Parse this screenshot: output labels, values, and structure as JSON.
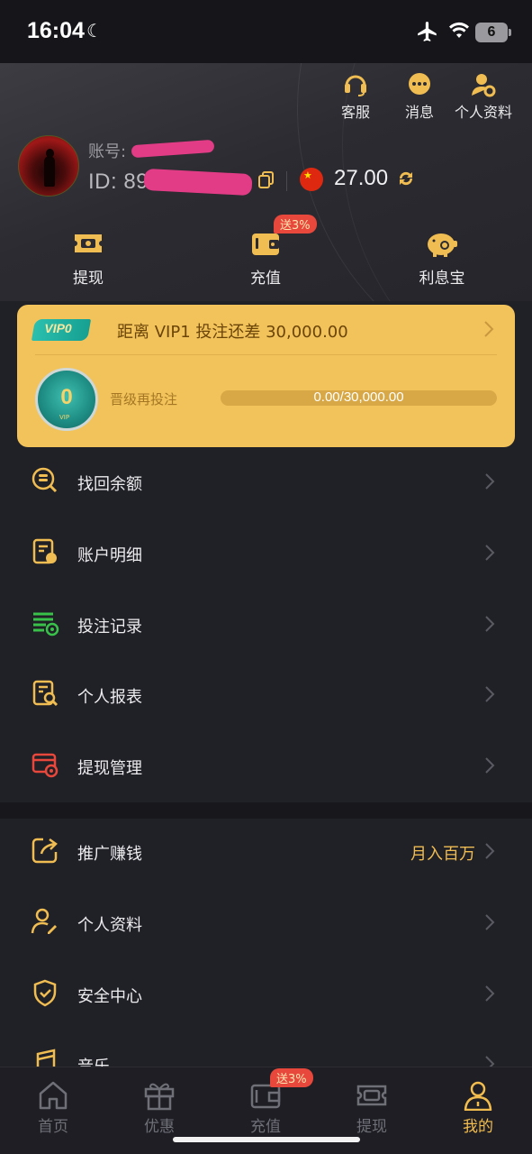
{
  "status_bar": {
    "time": "16:04",
    "battery": "6"
  },
  "header": {
    "actions": [
      {
        "label": "客服",
        "icon": "headset-icon"
      },
      {
        "label": "消息",
        "icon": "message-icon"
      },
      {
        "label": "个人资料",
        "icon": "user-settings-icon"
      }
    ],
    "account_label": "账号:",
    "id_label": "ID: 89",
    "balance": "27.00"
  },
  "quick_actions": [
    {
      "label": "提现",
      "icon": "withdraw-ticket-icon"
    },
    {
      "label": "充值",
      "icon": "wallet-icon",
      "badge": "送3%"
    },
    {
      "label": "利息宝",
      "icon": "piggy-bank-icon"
    }
  ],
  "vip": {
    "level_badge": "VIP0",
    "message": "距离 VIP1 投注还差 30,000.00",
    "medal_level": "0",
    "medal_caption": "VIP",
    "progress_label": "晋级再投注",
    "progress_text": "0.00/30,000.00",
    "progress_fraction": 0.0
  },
  "menu_group_1": [
    {
      "label": "找回余额",
      "icon": "recover-balance-icon",
      "color": "#f0bd52"
    },
    {
      "label": "账户明细",
      "icon": "account-detail-icon",
      "color": "#f0bd52"
    },
    {
      "label": "投注记录",
      "icon": "bet-record-icon",
      "color": "#39c24a"
    },
    {
      "label": "个人报表",
      "icon": "report-search-icon",
      "color": "#f0bd52"
    },
    {
      "label": "提现管理",
      "icon": "withdraw-manage-icon",
      "color": "#e8483c"
    }
  ],
  "menu_group_2": [
    {
      "label": "推广赚钱",
      "icon": "share-icon",
      "extra": "月入百万"
    },
    {
      "label": "个人资料",
      "icon": "user-edit-icon"
    },
    {
      "label": "安全中心",
      "icon": "shield-icon"
    },
    {
      "label": "音乐",
      "icon": "music-icon"
    }
  ],
  "bottom_nav": [
    {
      "label": "首页",
      "icon": "home-icon"
    },
    {
      "label": "优惠",
      "icon": "gift-icon"
    },
    {
      "label": "充值",
      "icon": "wallet-icon",
      "badge": "送3%"
    },
    {
      "label": "提现",
      "icon": "withdraw-ticket-icon"
    },
    {
      "label": "我的",
      "icon": "profile-icon",
      "active": true
    }
  ],
  "colors": {
    "accent": "#f0bd52",
    "vip_card": "#f2c35b",
    "badge_red": "#e8483c",
    "background": "#202027"
  }
}
